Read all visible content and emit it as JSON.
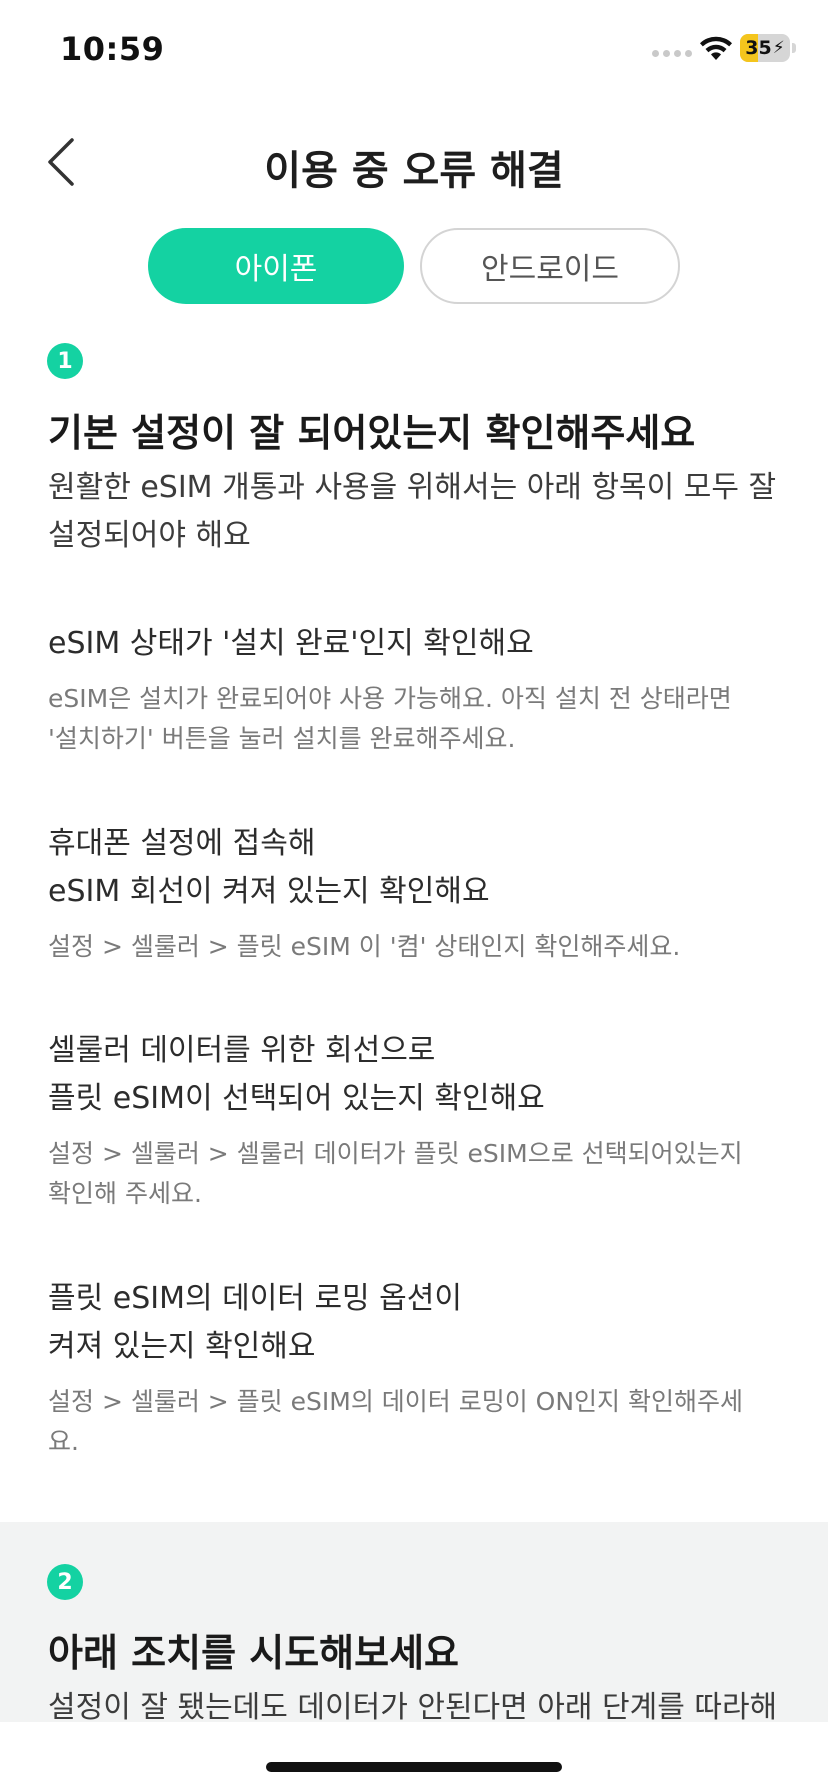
{
  "status_bar": {
    "time": "10:59",
    "battery_level": "35",
    "battery_fraction": 0.35,
    "battery_color": "#f4c51d",
    "icons": [
      "signal-dots-icon",
      "wifi-icon",
      "battery-icon"
    ]
  },
  "nav": {
    "back_icon": "chevron-left-icon",
    "title": "이용 중 오류 해결"
  },
  "tabs": [
    {
      "label": "아이폰",
      "active": true
    },
    {
      "label": "안드로이드",
      "active": false
    }
  ],
  "accent_color": "#14d2a2",
  "step1": {
    "number": "1",
    "title": "기본 설정이 잘 되어있는지 확인해주세요",
    "description_line1": "원활한 eSIM 개통과 사용을 위해서는 아래 항목이 모두 잘",
    "description_line2": "설정되어야 해요",
    "items": [
      {
        "title_line1": "eSIM 상태가 '설치 완료'인지 확인해요",
        "desc_line1": "eSIM은 설치가 완료되어야 사용 가능해요. 아직 설치 전 상태라면",
        "desc_line2": "'설치하기' 버튼을 눌러 설치를 완료해주세요."
      },
      {
        "title_line1": "휴대폰 설정에 접속해",
        "title_line2": "eSIM 회선이 켜져 있는지 확인해요",
        "desc_line1": "설정 > 셀룰러 > 플릿 eSIM 이 '켬' 상태인지 확인해주세요."
      },
      {
        "title_line1": "셀룰러 데이터를 위한 회선으로",
        "title_line2": "플릿 eSIM이 선택되어 있는지 확인해요",
        "desc_line1": "설정 > 셀룰러 > 셀룰러 데이터가 플릿 eSIM으로 선택되어있는지",
        "desc_line2": "확인해 주세요."
      },
      {
        "title_line1": "플릿 eSIM의 데이터 로밍 옵션이",
        "title_line2": "켜져 있는지 확인해요",
        "desc_line1": "설정 > 셀룰러 > 플릿 eSIM의 데이터 로밍이 ON인지 확인해주세",
        "desc_line2": "요."
      }
    ]
  },
  "step2": {
    "number": "2",
    "title": "아래 조치를 시도해보세요",
    "description_line1": "설정이 잘 됐는데도 데이터가 안된다면 아래 단계를 따라해"
  }
}
